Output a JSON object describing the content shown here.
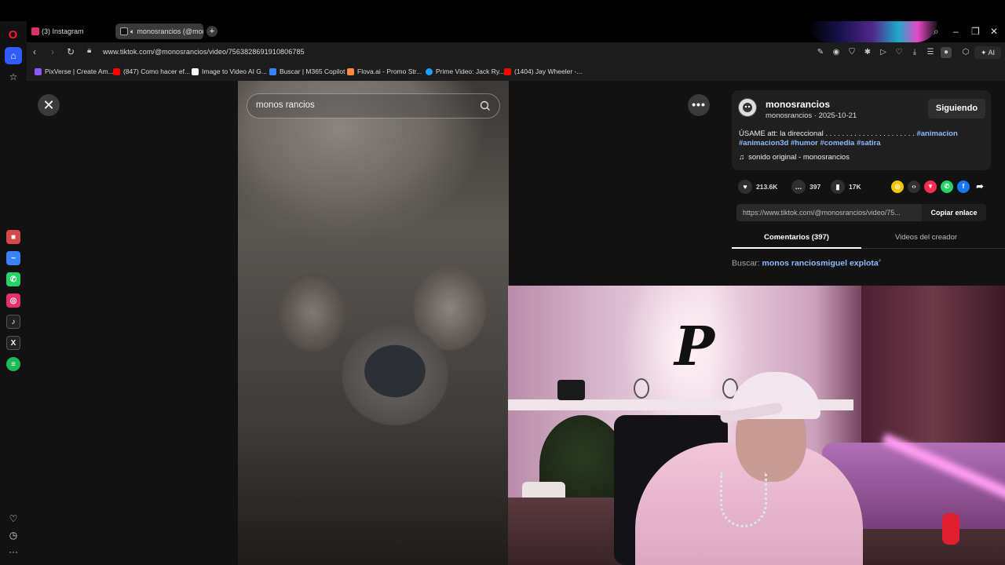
{
  "tabs": [
    {
      "label": "(3) Instagram",
      "color": "#e1306c"
    },
    {
      "label": "monosrancios (@mon",
      "color": "#111111"
    }
  ],
  "address": {
    "url": "www.tiktok.com/@monosrancios/video/7563828691910806785",
    "ai_label": "AI"
  },
  "bookmarks": [
    {
      "label": "PixVerse | Create Am...",
      "color": "#8a5cff"
    },
    {
      "label": "(847) Como hacer ef...",
      "color": "#ff0000"
    },
    {
      "label": "Image to Video AI G...",
      "color": "#ffffff"
    },
    {
      "label": "Buscar | M365 Copilot",
      "color": "#3b82f6"
    },
    {
      "label": "Flova.ai - Promo Str...",
      "color": "#ff8a3d"
    },
    {
      "label": "Prime Video: Jack Ry...",
      "color": "#1aa0ff"
    },
    {
      "label": "(1404) Jay Wheeler -...",
      "color": "#ff0000"
    }
  ],
  "video": {
    "search_text": "monos rancios"
  },
  "author": {
    "name": "monosrancios",
    "sub": "monosrancios · 2025-10-21",
    "follow_label": "Siguiendo",
    "desc_text": "ÚSAME att: la direccional . . . . . . . . . . . . . . . . . . . . . .",
    "tags": [
      "#animacion",
      "#animacion3d",
      "#humor",
      "#comedia",
      "#satira"
    ],
    "sound": "sonido original - monosrancios"
  },
  "actions": {
    "likes": "213.6K",
    "comments": "397",
    "saves": "17K"
  },
  "link": {
    "url": "https://www.tiktok.com/@monosrancios/video/75...",
    "copy_label": "Copiar enlace"
  },
  "panel_tabs": {
    "comments": "Comentarios (397)",
    "creator": "Videos del creador"
  },
  "search_row": {
    "label": "Buscar:",
    "query": "monos ranciosmiguel explota"
  },
  "colors": {
    "accent": "#2f5bff",
    "tag": "#8fbcff"
  }
}
